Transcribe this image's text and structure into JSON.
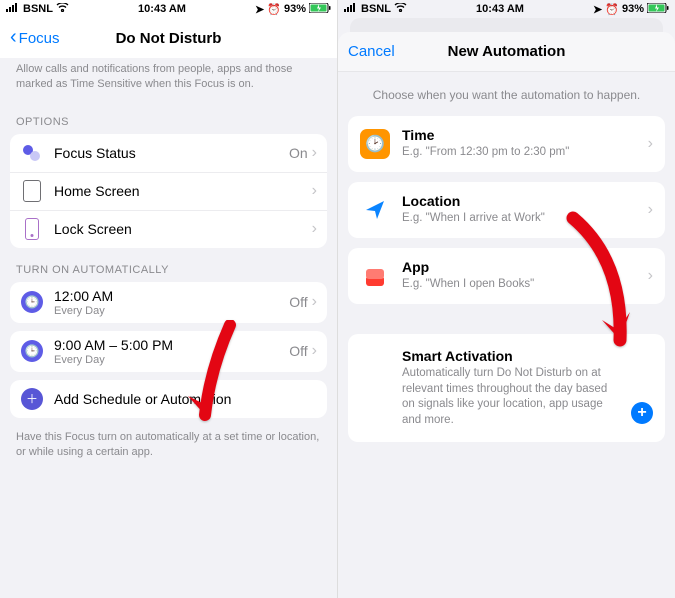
{
  "statusbar": {
    "carrier": "BSNL",
    "time": "10:43 AM",
    "battery_pct": "93%"
  },
  "leftPane": {
    "back_label": "Focus",
    "title": "Do Not Disturb",
    "intro": "Allow calls and notifications from people, apps and those marked as Time Sensitive when this Focus is on.",
    "section_options": "OPTIONS",
    "options": {
      "focus_status": {
        "label": "Focus Status",
        "value": "On"
      },
      "home_screen": {
        "label": "Home Screen"
      },
      "lock_screen": {
        "label": "Lock Screen"
      }
    },
    "section_auto": "TURN ON AUTOMATICALLY",
    "schedules": [
      {
        "time": "12:00 AM",
        "sub": "Every Day",
        "state": "Off"
      },
      {
        "time": "9:00 AM – 5:00 PM",
        "sub": "Every Day",
        "state": "Off"
      }
    ],
    "add_schedule": "Add Schedule or Automation",
    "footer": "Have this Focus turn on automatically at a set time or location, or while using a certain app."
  },
  "rightPane": {
    "cancel": "Cancel",
    "title": "New Automation",
    "subhead": "Choose when you want the automation to happen.",
    "triggers": {
      "time": {
        "title": "Time",
        "sub": "E.g. \"From 12:30 pm to 2:30 pm\""
      },
      "location": {
        "title": "Location",
        "sub": "E.g. \"When I arrive at Work\""
      },
      "app": {
        "title": "App",
        "sub": "E.g. \"When I open Books\""
      }
    },
    "smart": {
      "title": "Smart Activation",
      "sub": "Automatically turn Do Not Disturb on at relevant times throughout the day based on signals like your location, app usage and more."
    }
  }
}
